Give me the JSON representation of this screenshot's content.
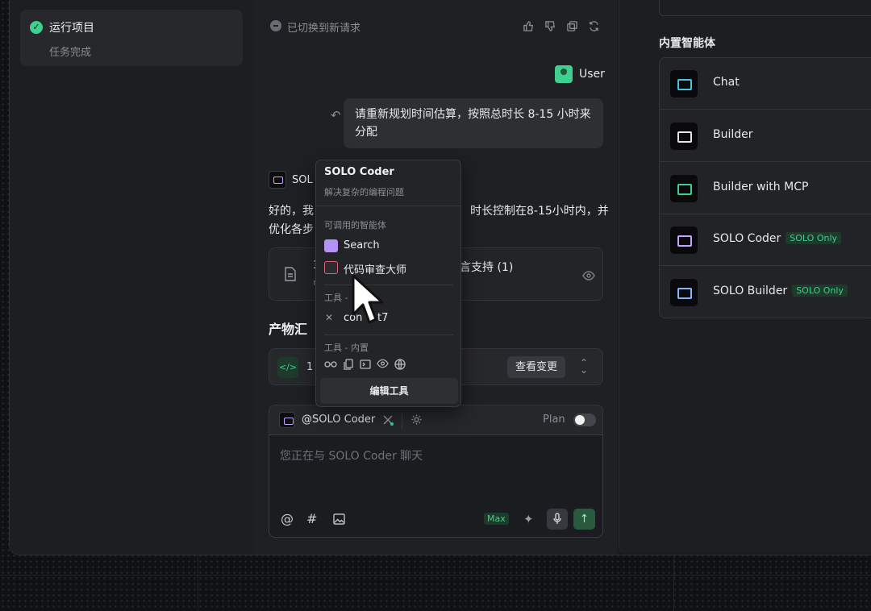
{
  "sidebar": {
    "task_title": "运行项目",
    "task_status": "任务完成"
  },
  "chat": {
    "switched_notice": "已切换到新请求",
    "user_label": "User",
    "user_message": "请重新规划时间估算，按照总时长 8-15 小时来分配",
    "agent_label_visible": "SOL",
    "reply_line1_start": "好的，我",
    "reply_line1_end": "时长控制在8-15小时内，并",
    "reply_line2_start": "优化各步",
    "file_card_text": "言支持 (1)",
    "file_card_partial_left": "3",
    "file_card_partial_sub": "r",
    "artifacts_heading": "产物汇",
    "artifact_count_partial": "1",
    "view_changes_label": "查看变更"
  },
  "composer": {
    "agent_mention": "@SOLO Coder",
    "plan_label": "Plan",
    "placeholder": "您正在与 SOLO Coder 聊天",
    "max_label": "Max"
  },
  "popup": {
    "title": "SOLO Coder",
    "subtitle": "解决复杂的编程问题",
    "callable_heading": "可调用的智能体",
    "callable_agents": [
      "Search",
      "代码审查大师"
    ],
    "tools_mcp_heading": "工具 -",
    "mcp_tool_partial_left": "con",
    "mcp_tool_partial_right": "t7",
    "tools_builtin_heading": "工具 - 内置",
    "edit_tools_label": "编辑工具"
  },
  "right_panel": {
    "heading": "内置智能体",
    "agents": [
      {
        "name": "Chat",
        "color": "#3ec7e0",
        "badge": ""
      },
      {
        "name": "Builder",
        "color": "#e6e7ea",
        "badge": ""
      },
      {
        "name": "Builder with MCP",
        "color": "#3fcf8e",
        "badge": ""
      },
      {
        "name": "SOLO Coder",
        "color": "#c7a4ff",
        "badge": "SOLO Only"
      },
      {
        "name": "SOLO Builder",
        "color": "#7ab8ff",
        "badge": "SOLO Only"
      }
    ]
  },
  "colors": {
    "accent_green": "#3fcf8e",
    "solo_purple": "#c7a4ff",
    "background": "#1a1b1e"
  }
}
